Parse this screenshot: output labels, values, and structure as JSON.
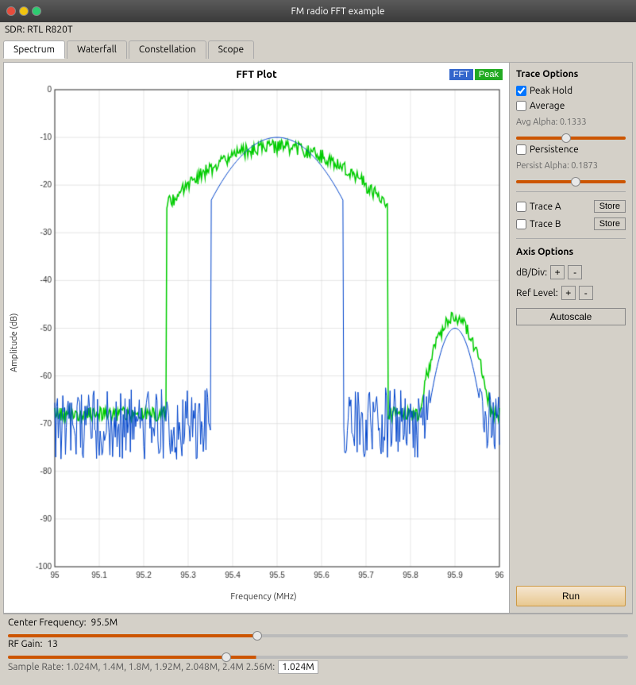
{
  "window": {
    "title": "FM radio FFT example"
  },
  "sdr": {
    "label": "SDR: RTL R820T"
  },
  "tabs": [
    {
      "label": "Spectrum",
      "active": true
    },
    {
      "label": "Waterfall",
      "active": false
    },
    {
      "label": "Constellation",
      "active": false
    },
    {
      "label": "Scope",
      "active": false
    }
  ],
  "plot": {
    "title": "FFT Plot",
    "fft_btn": "FFT",
    "peak_btn": "Peak",
    "y_axis_label": "Amplitude (dB)",
    "x_axis_label": "Frequency (MHz)",
    "y_min": -100,
    "y_max": 0,
    "x_min": 95,
    "x_max": 96,
    "y_ticks": [
      0,
      -10,
      -20,
      -30,
      -40,
      -50,
      -60,
      -70,
      -80,
      -90,
      -100
    ],
    "x_ticks": [
      95,
      95.1,
      95.2,
      95.3,
      95.4,
      95.5,
      95.6,
      95.7,
      95.8,
      95.9,
      96
    ]
  },
  "trace_options": {
    "title": "Trace Options",
    "peak_hold": {
      "label": "Peak Hold",
      "checked": true
    },
    "average": {
      "label": "Average",
      "checked": false
    },
    "avg_alpha": {
      "label": "Avg Alpha: 0.1333",
      "value": 0.45
    },
    "persistence": {
      "label": "Persistence",
      "checked": false
    },
    "persist_alpha": {
      "label": "Persist Alpha: 0.1873",
      "value": 0.55
    },
    "trace_a": {
      "label": "Trace A",
      "checked": false,
      "store_btn": "Store"
    },
    "trace_b": {
      "label": "Trace B",
      "checked": false,
      "store_btn": "Store"
    }
  },
  "axis_options": {
    "title": "Axis Options",
    "db_div": {
      "label": "dB/Div:",
      "plus": "+",
      "minus": "-"
    },
    "ref_level": {
      "label": "Ref Level:",
      "plus": "+",
      "minus": "-"
    },
    "autoscale_btn": "Autoscale"
  },
  "run_btn": "Run",
  "controls": {
    "center_freq": {
      "label": "Center Frequency:",
      "value": "95.5M",
      "slider_value": 0.4
    },
    "rf_gain": {
      "label": "RF Gain:",
      "value": "13",
      "slider_value": 0.35
    },
    "sample_rate": {
      "label": "Sample Rate: 1.024M, 1.4M, 1.8M, 1.92M, 2.048M, 2.4M  2.56M:",
      "value": "1.024M"
    }
  }
}
